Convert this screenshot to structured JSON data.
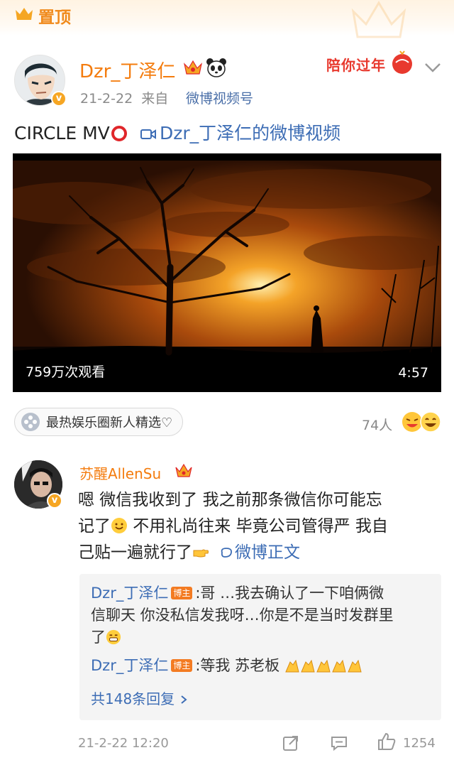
{
  "pin": {
    "label": "置顶"
  },
  "post": {
    "author": "Dzr_丁泽仁",
    "date": "21-2-22",
    "source_prefix": "来自",
    "source": "微博视频号",
    "badge_text": "陪你过年",
    "title": "CIRCLE MV",
    "video_link": "Dzr_丁泽仁的微博视频",
    "video": {
      "views": "759万次观看",
      "duration": "4:57"
    },
    "supertopic": "最热娱乐圈新人精选♡",
    "likes": "74人"
  },
  "comment": {
    "author": "苏醒AllenSu",
    "line1": "嗯 微信我收到了 我之前那条微信你可能忘",
    "line2a": "记了",
    "line2b": " 不用礼尚往来 毕竟公司管得严 我自",
    "line3": "己贴一遍就行了",
    "weibo_link": "微博正文",
    "time": "21-2-22 12:20",
    "like_count": "1254"
  },
  "replies": {
    "items": [
      {
        "name": "Dzr_丁泽仁",
        "badge": "博主",
        "text1": ":哥 …我去确认了一下咱俩微",
        "text2": "信聊天 你没私信发我呀…你是不是当时发群里",
        "text3": "了"
      },
      {
        "name": "Dzr_丁泽仁",
        "badge": "博主",
        "text1": ":等我 苏老板"
      }
    ],
    "more": "共148条回复"
  },
  "colors": {
    "accent": "#f47c0e",
    "link": "#3d6db5",
    "red": "#e0262a"
  }
}
